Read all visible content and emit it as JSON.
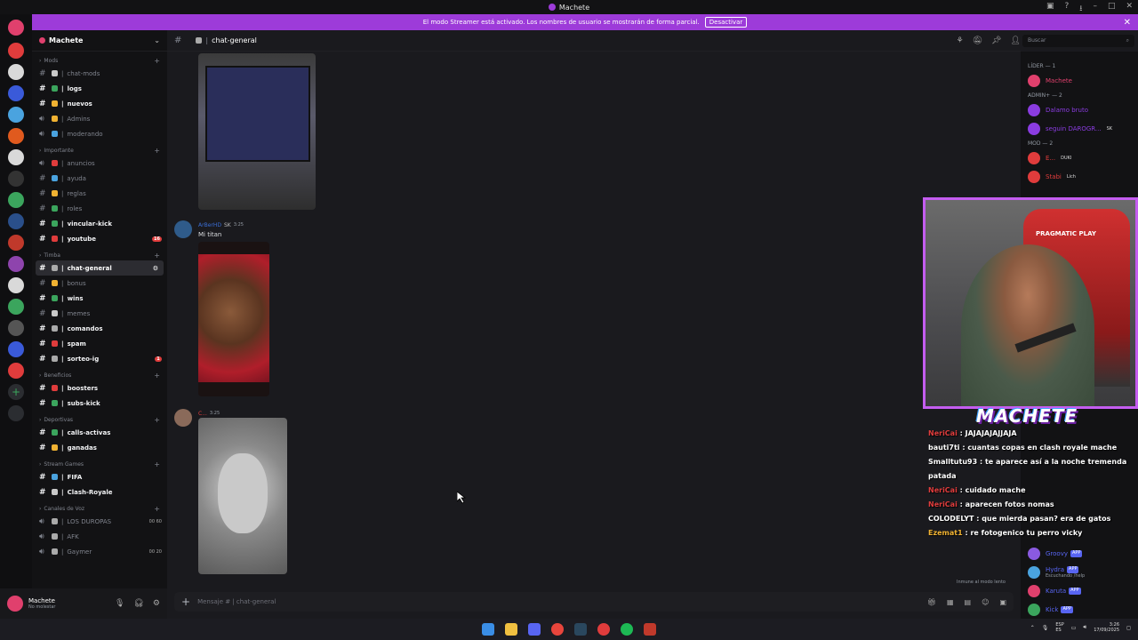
{
  "window": {
    "title": "Machete"
  },
  "streamer_bar": {
    "text": "El modo Streamer está activado. Los nombres de usuario se mostrarán de forma parcial.",
    "button": "Desactivar"
  },
  "server": {
    "name": "Machete"
  },
  "categories": [
    {
      "name": "Mods",
      "channels": [
        {
          "name": "chat-mods",
          "bright": false,
          "color": "#c9c9c9"
        },
        {
          "name": "logs",
          "bright": true,
          "color": "#3ba55d"
        },
        {
          "name": "nuevos",
          "bright": true,
          "color": "#f0b232"
        },
        {
          "name": "Admins",
          "bright": false,
          "color": "#f0b232",
          "voice": true
        },
        {
          "name": "moderando",
          "bright": false,
          "color": "#4aa3df",
          "voice": true
        }
      ]
    },
    {
      "name": "Importante",
      "channels": [
        {
          "name": "anuncios",
          "bright": false,
          "color": "#e03c3c",
          "voice": true
        },
        {
          "name": "ayuda",
          "bright": false,
          "color": "#4aa3df"
        },
        {
          "name": "reglas",
          "bright": false,
          "color": "#f0b232"
        },
        {
          "name": "roles",
          "bright": false,
          "color": "#3ba55d"
        },
        {
          "name": "vincular-kick",
          "bright": true,
          "color": "#3ba55d"
        },
        {
          "name": "youtube",
          "bright": true,
          "color": "#e03c3c",
          "badge": "16"
        }
      ]
    },
    {
      "name": "Timba",
      "channels": [
        {
          "name": "chat-general",
          "bright": true,
          "color": "#aaaaaa",
          "active": true
        },
        {
          "name": "bonus",
          "bright": false,
          "color": "#f0b232"
        },
        {
          "name": "wins",
          "bright": true,
          "color": "#3ba55d"
        },
        {
          "name": "memes",
          "bright": false,
          "color": "#c9c9c9"
        },
        {
          "name": "comandos",
          "bright": true,
          "color": "#aaaaaa"
        },
        {
          "name": "spam",
          "bright": true,
          "color": "#e03c3c"
        },
        {
          "name": "sorteo-ig",
          "bright": true,
          "color": "#aaaaaa",
          "badge": "1"
        }
      ]
    },
    {
      "name": "Beneficios",
      "channels": [
        {
          "name": "boosters",
          "bright": true,
          "color": "#e03c3c"
        },
        {
          "name": "subs-kick",
          "bright": true,
          "color": "#3ba55d"
        }
      ]
    },
    {
      "name": "Deportivas",
      "channels": [
        {
          "name": "calls-activas",
          "bright": true,
          "color": "#3ba55d"
        },
        {
          "name": "ganadas",
          "bright": true,
          "color": "#f0b232"
        }
      ]
    },
    {
      "name": "Stream Games",
      "channels": [
        {
          "name": "FIFA",
          "bright": true,
          "color": "#4aa3df"
        },
        {
          "name": "Clash-Royale",
          "bright": true,
          "color": "#c9c9c9"
        }
      ]
    },
    {
      "name": "Canales de Voz",
      "channels": [
        {
          "name": "LOS DUROPAS",
          "bright": false,
          "color": "#aaaaaa",
          "voice": true,
          "count": "00 60"
        },
        {
          "name": "AFK",
          "bright": false,
          "color": "#aaaaaa",
          "voice": true
        },
        {
          "name": "Gaymer",
          "bright": false,
          "color": "#aaaaaa",
          "voice": true,
          "count": "00 20"
        }
      ]
    }
  ],
  "current_user": {
    "name": "Machete",
    "status": "No molestar"
  },
  "chat": {
    "channel_name": "chat-general",
    "search_placeholder": "Buscar",
    "composer_placeholder": "Mensaje # | chat-general",
    "messages": [
      {
        "author": "ArBerHD",
        "tag": "SK",
        "time": "3:25",
        "text": "Mi titan"
      },
      {
        "author": "C...",
        "tag": "",
        "time": "3:25",
        "text": ""
      }
    ],
    "immune_note": "Inmune al modo lento"
  },
  "members": {
    "groups": [
      {
        "title": "LÍDER — 1",
        "members": [
          {
            "name": "Machete",
            "color": "#e0406d"
          }
        ]
      },
      {
        "title": "ADMIN+ — 2",
        "members": [
          {
            "name": "Dalamo bruto",
            "color": "#8a3ce0"
          },
          {
            "name": "seguin DAROGR...",
            "color": "#8a3ce0",
            "tag": "SK"
          }
        ]
      },
      {
        "title": "MOD — 2",
        "members": [
          {
            "name": "E...",
            "color": "#e03c3c",
            "tag": "DUKI"
          },
          {
            "name": "Stabi",
            "color": "#e03c3c",
            "tag": "Lich"
          }
        ]
      }
    ],
    "bots": [
      {
        "name": "Groovy",
        "tag": "APP"
      },
      {
        "name": "Hydra",
        "tag": "APP",
        "sub": "Escuchando /help"
      },
      {
        "name": "Karuta",
        "tag": "APP"
      },
      {
        "name": "Kick",
        "tag": "APP"
      }
    ]
  },
  "overlay": {
    "logo": "MACHETE",
    "sponsor": "PRAGMATIC PLAY",
    "chat": [
      {
        "user": "NeriCai",
        "text": "JAJAJAJAJJAJA",
        "color": "#e03c3c"
      },
      {
        "user": "bauti7ti",
        "text": "cuantas copas en clash royale mache",
        "color": "#ffffff"
      },
      {
        "user": "Smalltutu93",
        "text": "te aparece así a la noche tremenda patada",
        "color": "#ffffff"
      },
      {
        "user": "NeriCai",
        "text": "cuidado mache",
        "color": "#e03c3c"
      },
      {
        "user": "NeriCai",
        "text": "aparecen fotos nomas",
        "color": "#e03c3c"
      },
      {
        "user": "COLODELYT",
        "text": "que mierda pasan? era de gatos",
        "color": "#ffffff"
      },
      {
        "user": "Ezemat1",
        "text": "re fotogenico tu perro vicky",
        "color": "#f0b232"
      }
    ]
  },
  "tray": {
    "lang": "ESP",
    "lang_sub": "ES",
    "time": "3:26",
    "date": "17/09/2025"
  }
}
